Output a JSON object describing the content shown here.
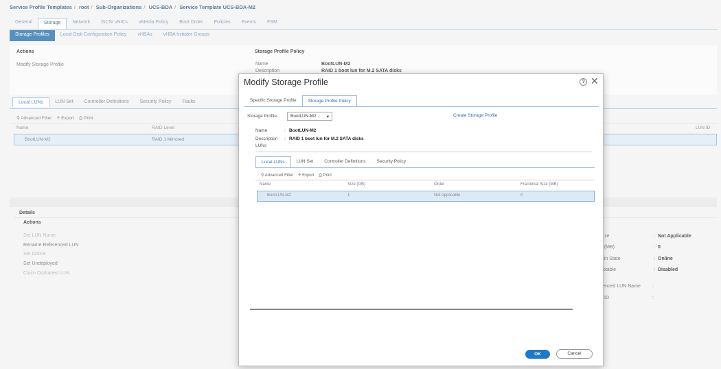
{
  "breadcrumb": [
    "Service Profile Templates",
    "root",
    "Sub-Organizations",
    "UCS-BDA",
    "Service Template UCS-BDA-M2"
  ],
  "breadcrumb_sep": "/",
  "main_tabs": [
    "General",
    "Storage",
    "Network",
    "iSCSI vNICs",
    "vMedia Policy",
    "Boot Order",
    "Policies",
    "Events",
    "FSM"
  ],
  "sub_tabs": [
    "Storage Profiles",
    "Local Disk Configuration Policy",
    "vHBAs",
    "vHBA Initiator Groups"
  ],
  "actions": {
    "title": "Actions",
    "items": [
      "Modify Storage Profile"
    ]
  },
  "storage_profile_policy": {
    "title": "Storage Profile Policy",
    "name_label": "Name",
    "name_value": "BootLUN-M2",
    "desc_label": "Description",
    "desc_value": "RAID 1 boot lun for M.2 SATA disks"
  },
  "bg_lun_tabs": [
    "Local LUNs",
    "LUN Set",
    "Controller Definitions",
    "Security Policy",
    "Faults"
  ],
  "bg_toolbar": {
    "filter": "Advanced Filter",
    "export": "Export",
    "print": "Print"
  },
  "bg_table": {
    "headers": [
      "Name",
      "RAID Level",
      "LUN ID"
    ],
    "row": [
      "BootLUN-M2",
      "RAID 1 Mirrored"
    ]
  },
  "details": {
    "title": "Details",
    "actions_title": "Actions",
    "actions": [
      "Set LUN Name",
      "Rename Referenced LUN",
      "Set Online",
      "Set Undeployed",
      "Claim Orphaned LUN"
    ],
    "props": [
      {
        "label": "ze",
        "value": "Not Applicable"
      },
      {
        "label": "e (MB)",
        "value": "0"
      },
      {
        "label": "nin State",
        "value": "Online"
      },
      {
        "label": "ptable",
        "value": "Disabled"
      },
      {
        "label": "erenced LUN Name",
        "value": ""
      },
      {
        "label": "ID",
        "value": ""
      }
    ]
  },
  "modal": {
    "title": "Modify Storage Profile",
    "help": "?",
    "close": "✕",
    "tabs": [
      "Specific Storage Profile",
      "Storage Profile Policy"
    ],
    "storage_profile_label": "Storage Profile:",
    "storage_profile_value": "BootLUN-M2",
    "create_link": "Create Storage Profile",
    "name_label": "Name",
    "name_value": "BootLUN-M2",
    "desc_label": "Description",
    "desc_value": "RAID 1 boot lun for M.2 SATA disks",
    "luns_label": "LUNs",
    "lun_tabs": [
      "Local LUNs",
      "LUN Set",
      "Controller Definitions",
      "Security Policy"
    ],
    "toolbar": {
      "filter": "Advanced Filter",
      "export": "Export",
      "print": "Print"
    },
    "table": {
      "headers": [
        "Name",
        "Size (GB)",
        "Order",
        "Fractional Size (MB)"
      ],
      "row": [
        "BootLUN-M2",
        "1",
        "Not Applicable",
        "0"
      ]
    },
    "ok": "OK",
    "cancel": "Cancel"
  }
}
